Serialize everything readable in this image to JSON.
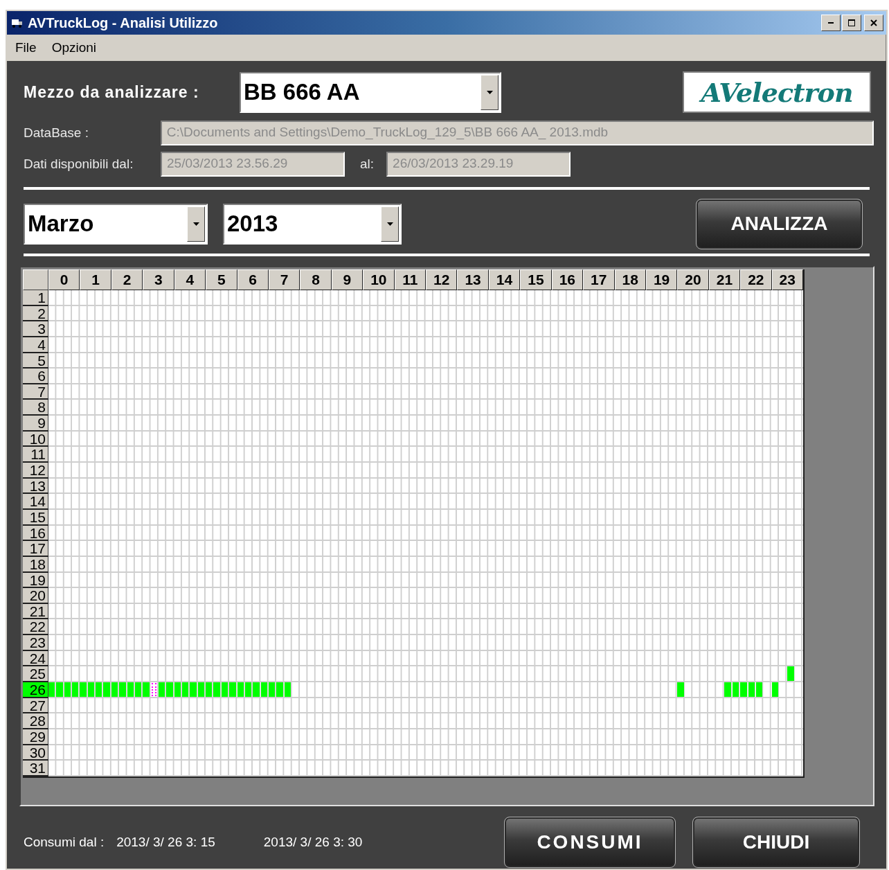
{
  "window": {
    "title": "AVTruckLog - Analisi Utilizzo"
  },
  "menu": [
    "File",
    "Opzioni"
  ],
  "vehicle": {
    "label": "Mezzo da analizzare :",
    "value": "BB 666 AA"
  },
  "logo": {
    "text": "AVelectron"
  },
  "database": {
    "label": "DataBase :",
    "value": "C:\\Documents and Settings\\Demo_TruckLog_129_5\\BB 666 AA_ 2013.mdb"
  },
  "range": {
    "label": "Dati disponibili dal:",
    "from": "25/03/2013 23.56.29",
    "to_label": "al:",
    "to": "26/03/2013 23.29.19"
  },
  "period": {
    "month": "Marzo",
    "year": "2013"
  },
  "analyze_button": "ANALIZZA",
  "grid": {
    "hours": [
      "0",
      "1",
      "2",
      "3",
      "4",
      "5",
      "6",
      "7",
      "8",
      "9",
      "10",
      "11",
      "12",
      "13",
      "14",
      "15",
      "16",
      "17",
      "18",
      "19",
      "20",
      "21",
      "22",
      "23"
    ],
    "days": [
      {
        "label": "1",
        "selected": false
      },
      {
        "label": "2",
        "selected": false
      },
      {
        "label": "3",
        "selected": false
      },
      {
        "label": "4",
        "selected": false
      },
      {
        "label": "5",
        "selected": false
      },
      {
        "label": "6",
        "selected": false
      },
      {
        "label": "7",
        "selected": false
      },
      {
        "label": "8",
        "selected": false
      },
      {
        "label": "9",
        "selected": false
      },
      {
        "label": "10",
        "selected": false
      },
      {
        "label": "11",
        "selected": false
      },
      {
        "label": "12",
        "selected": false
      },
      {
        "label": "13",
        "selected": false
      },
      {
        "label": "14",
        "selected": false
      },
      {
        "label": "15",
        "selected": false
      },
      {
        "label": "16",
        "selected": false
      },
      {
        "label": "17",
        "selected": false
      },
      {
        "label": "18",
        "selected": false
      },
      {
        "label": "19",
        "selected": false
      },
      {
        "label": "20",
        "selected": false
      },
      {
        "label": "21",
        "selected": false
      },
      {
        "label": "22",
        "selected": false
      },
      {
        "label": "23",
        "selected": false
      },
      {
        "label": "24",
        "selected": false
      },
      {
        "label": "25",
        "selected": false,
        "cells": [
          false,
          false,
          false,
          false,
          false,
          false,
          false,
          false,
          false,
          false,
          false,
          false,
          false,
          false,
          false,
          false,
          false,
          false,
          false,
          false,
          false,
          false,
          false,
          false,
          false,
          false,
          false,
          false,
          false,
          false,
          false,
          false,
          false,
          false,
          false,
          false,
          false,
          false,
          false,
          false,
          false,
          false,
          false,
          false,
          false,
          false,
          false,
          false,
          false,
          false,
          false,
          false,
          false,
          false,
          false,
          false,
          false,
          false,
          false,
          false,
          false,
          false,
          false,
          false,
          false,
          false,
          false,
          false,
          false,
          false,
          false,
          false,
          false,
          false,
          false,
          false,
          false,
          false,
          false,
          false,
          false,
          false,
          false,
          false,
          false,
          false,
          false,
          false,
          false,
          false,
          false,
          false,
          false,
          false,
          true,
          false
        ]
      },
      {
        "label": "26",
        "selected": true,
        "cells": [
          true,
          true,
          true,
          true,
          true,
          true,
          true,
          true,
          true,
          true,
          true,
          true,
          true,
          false,
          true,
          true,
          true,
          true,
          true,
          true,
          true,
          true,
          true,
          true,
          true,
          true,
          true,
          true,
          true,
          true,
          true,
          false,
          false,
          false,
          false,
          false,
          false,
          false,
          false,
          false,
          false,
          false,
          false,
          false,
          false,
          false,
          false,
          false,
          false,
          false,
          false,
          false,
          false,
          false,
          false,
          false,
          false,
          false,
          false,
          false,
          false,
          false,
          false,
          false,
          false,
          false,
          false,
          false,
          false,
          false,
          false,
          false,
          false,
          false,
          false,
          false,
          false,
          false,
          false,
          false,
          true,
          false,
          false,
          false,
          false,
          false,
          true,
          true,
          true,
          true,
          true,
          false,
          true,
          false,
          false,
          false
        ],
        "focused": [
          false,
          false,
          false,
          false,
          false,
          false,
          false,
          false,
          false,
          false,
          false,
          false,
          false,
          true,
          false,
          false,
          false,
          false,
          false,
          false,
          false,
          false,
          false,
          false,
          false,
          false,
          false,
          false,
          false,
          false,
          false,
          false,
          false,
          false,
          false,
          false,
          false,
          false,
          false,
          false,
          false,
          false,
          false,
          false,
          false,
          false,
          false,
          false,
          false,
          false,
          false,
          false,
          false,
          false,
          false,
          false,
          false,
          false,
          false,
          false,
          false,
          false,
          false,
          false,
          false,
          false,
          false,
          false,
          false,
          false,
          false,
          false,
          false,
          false,
          false,
          false,
          false,
          false,
          false,
          false,
          false,
          false,
          false,
          false,
          false,
          false,
          false,
          false,
          false,
          false,
          false,
          false,
          false,
          false,
          false,
          false
        ]
      },
      {
        "label": "27",
        "selected": false
      },
      {
        "label": "28",
        "selected": false
      },
      {
        "label": "29",
        "selected": false
      },
      {
        "label": "30",
        "selected": false
      },
      {
        "label": "31",
        "selected": false
      }
    ]
  },
  "footer": {
    "label": "Consumi dal :",
    "from": "2013/ 3/ 26 3: 15",
    "to": "2013/ 3/ 26 3: 30"
  },
  "buttons": [
    "CONSUMI",
    "CHIUDI"
  ]
}
